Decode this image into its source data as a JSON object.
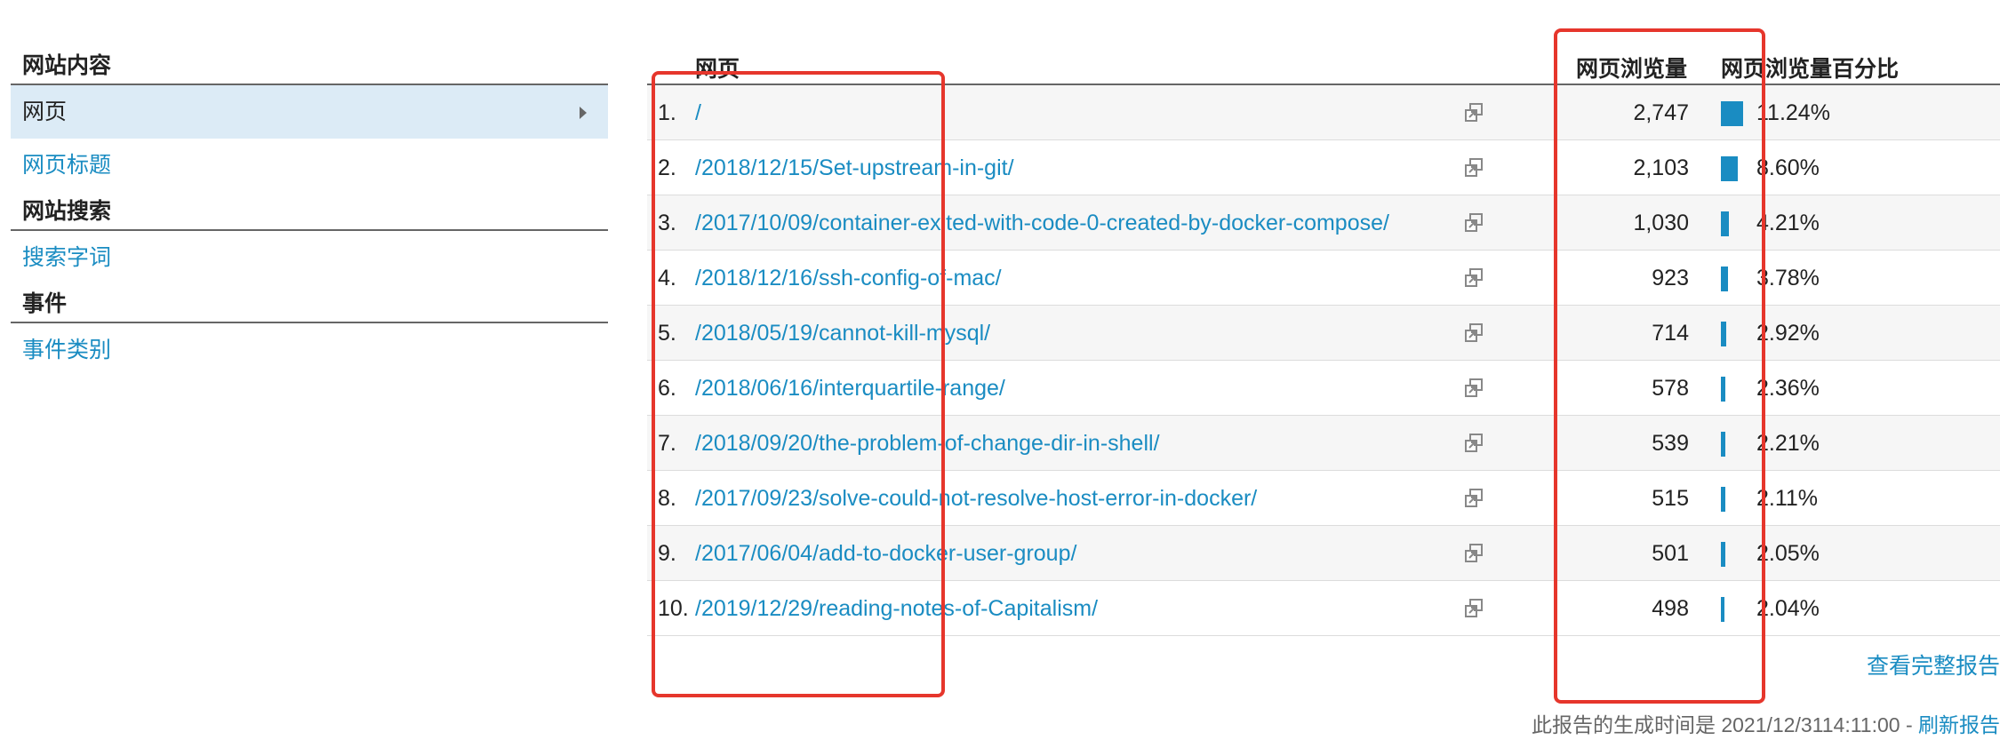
{
  "sidebar": {
    "sections": [
      {
        "heading": "网站内容",
        "items": [
          {
            "label": "网页"
          },
          {
            "label": "网页标题"
          }
        ]
      },
      {
        "heading": "网站搜索",
        "items": [
          {
            "label": "搜索字词"
          }
        ]
      },
      {
        "heading": "事件",
        "items": [
          {
            "label": "事件类别"
          }
        ]
      }
    ]
  },
  "table": {
    "headers": {
      "page": "网页",
      "views": "网页浏览量",
      "pct": "网页浏览量百分比"
    },
    "rows": [
      {
        "rank": "1.",
        "url": "/",
        "views": "2,747",
        "pct": "11.24%",
        "share": 0.1124
      },
      {
        "rank": "2.",
        "url": "/2018/12/15/Set-upstream-in-git/",
        "views": "2,103",
        "pct": "8.60%",
        "share": 0.086
      },
      {
        "rank": "3.",
        "url": "/2017/10/09/container-exited-with-code-0-created-by-docker-compose/",
        "views": "1,030",
        "pct": "4.21%",
        "share": 0.0421
      },
      {
        "rank": "4.",
        "url": "/2018/12/16/ssh-config-of-mac/",
        "views": "923",
        "pct": "3.78%",
        "share": 0.0378
      },
      {
        "rank": "5.",
        "url": "/2018/05/19/cannot-kill-mysql/",
        "views": "714",
        "pct": "2.92%",
        "share": 0.0292
      },
      {
        "rank": "6.",
        "url": "/2018/06/16/interquartile-range/",
        "views": "578",
        "pct": "2.36%",
        "share": 0.0236
      },
      {
        "rank": "7.",
        "url": "/2018/09/20/the-problem-of-change-dir-in-shell/",
        "views": "539",
        "pct": "2.21%",
        "share": 0.0221
      },
      {
        "rank": "8.",
        "url": "/2017/09/23/solve-could-not-resolve-host-error-in-docker/",
        "views": "515",
        "pct": "2.11%",
        "share": 0.0211
      },
      {
        "rank": "9.",
        "url": "/2017/06/04/add-to-docker-user-group/",
        "views": "501",
        "pct": "2.05%",
        "share": 0.0205
      },
      {
        "rank": "10.",
        "url": "/2019/12/29/reading-notes-of-Capitalism/",
        "views": "498",
        "pct": "2.04%",
        "share": 0.0204
      }
    ]
  },
  "footer": {
    "full_report": "查看完整报告",
    "generated": "此报告的生成时间是 2021/12/3114:11:00 - ",
    "refresh": "刷新报告"
  },
  "icons": {
    "row_action": "open-in-new-window-icon",
    "selected_arrow": "caret-right-icon"
  },
  "colors": {
    "link": "#1a8cc2",
    "selected_bg": "#dcebf6",
    "bar": "#1a8cc2",
    "annotation": "#e6362c"
  }
}
